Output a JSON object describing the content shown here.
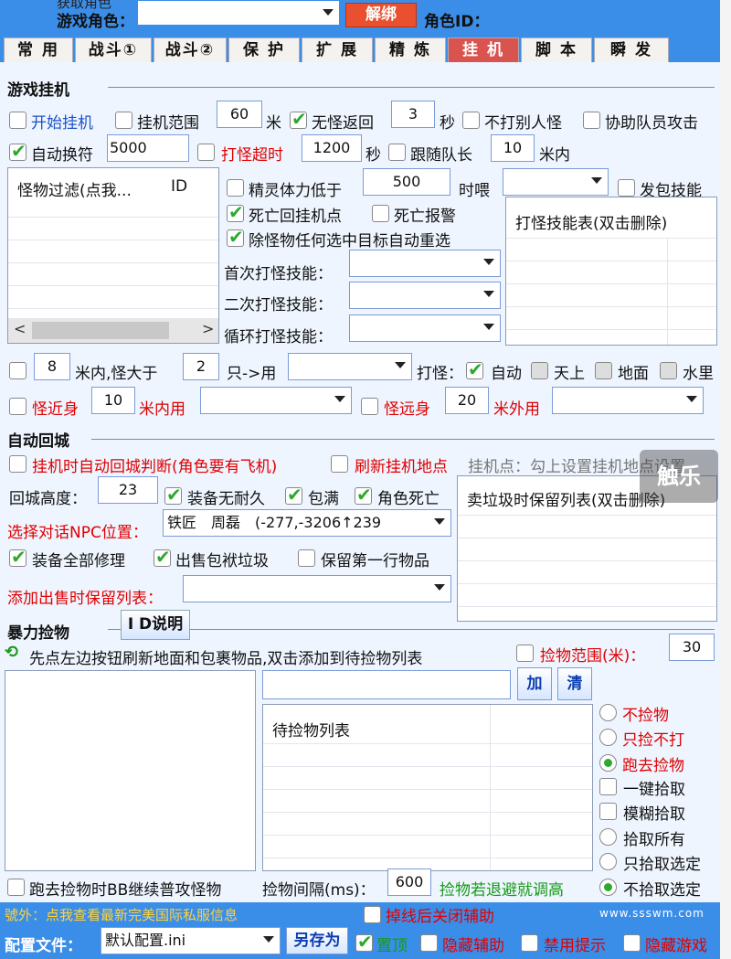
{
  "header": {
    "partial_label": "获取角色",
    "role_label": "游戏角色：",
    "unbind_button": "解绑",
    "role_id_label": "角色ID："
  },
  "tabs": [
    "常 用",
    "战斗①",
    "战斗②",
    "保 护",
    "扩 展",
    "精 炼",
    "挂 机",
    "脚 本",
    "瞬 发"
  ],
  "active_tab": "挂 机",
  "hang": {
    "title": "游戏挂机",
    "start_hang": "开始挂机",
    "hang_range": "挂机范围",
    "hang_range_value": "60",
    "meter": "米",
    "no_monster_return": "无怪返回",
    "no_monster_seconds": "3",
    "seconds": "秒",
    "no_attack_others": "不打别人怪",
    "assist_team": "协助队员攻击",
    "auto_talisman": "自动换符",
    "auto_talisman_value": "5000",
    "attack_timeout": "打怪超时",
    "attack_timeout_value": "1200",
    "seconds2": "秒",
    "follow_leader": "跟随队长",
    "follow_leader_value": "10",
    "within_meters": "米内",
    "filter_col1": "怪物过滤(点我...",
    "filter_col2": "ID",
    "spirit_low": "精灵体力低于",
    "spirit_value": "500",
    "feed_label": "时喂",
    "packet_skill": "发包技能",
    "death_return": "死亡回挂机点",
    "death_alarm": "死亡报警",
    "auto_reselect": "除怪物任何选中目标自动重选",
    "first_skill": "首次打怪技能：",
    "second_skill": "二次打怪技能：",
    "loop_skill": "循环打怪技能：",
    "skill_table": "打怪技能表(双击删除)",
    "range_value": "8",
    "range_text": "米内,怪大于",
    "count_value": "2",
    "use_text": "只->用",
    "attack_label": "打怪：",
    "auto": "自动",
    "sky": "天上",
    "ground": "地面",
    "water": "水里",
    "near_label": "怪近身",
    "near_value": "10",
    "near_use": "米内用",
    "far_label": "怪远身",
    "far_value": "20",
    "far_use": "米外用"
  },
  "town": {
    "title": "自动回城",
    "auto_return_check": "挂机时自动回城判断(角色要有飞机)",
    "refresh_point": "刷新挂机地点",
    "hang_point_hint": "挂机点：勾上设置挂机地点设置",
    "height_label": "回城高度：",
    "height_value": "23",
    "no_durability": "装备无耐久",
    "bag_full": "包满",
    "char_dead": "角色死亡",
    "npc_label": "选择对话NPC位置：",
    "npc_value": "铁匠　周磊　(-277,-3206↑239",
    "keep_list": "卖垃圾时保留列表(双击删除)",
    "repair_all": "装备全部修理",
    "sell_junk": "出售包袱垃圾",
    "keep_first_row": "保留第一行物品",
    "add_keep_label": "添加出售时保留列表："
  },
  "pickup": {
    "title": "暴力捡物",
    "id_help": "I D说明",
    "hint": "先点左边按钮刷新地面和包裹物品,双击添加到待捡物列表",
    "range_label": "捡物范围(米)：",
    "range_value": "30",
    "add_btn": "加",
    "clear_btn": "清",
    "pending_list": "待捡物列表",
    "options": [
      "不捡物",
      "只捡不打",
      "跑去捡物"
    ],
    "one_click": "一键拾取",
    "fuzzy": "模糊拾取",
    "pick_modes": [
      "拾取所有",
      "只拾取选定",
      "不拾取选定"
    ],
    "bb_attack": "跑去捡物时BB继续普攻怪物",
    "interval_label": "捡物间隔(ms)：",
    "interval_value": "600",
    "dodge_hint": "捡物若退避就调高"
  },
  "footer": {
    "news": "號外：点我查看最新完美国际私服信息",
    "close_on_disconnect": "掉线后关闭辅助",
    "website": "www.ssswm.com",
    "config_label": "配置文件：",
    "config_value": "默认配置.ini",
    "save_as": "另存为",
    "topmost": "置顶",
    "hide_helper": "隐藏辅助",
    "disable_tips": "禁用提示",
    "hide_game": "隐藏游戏"
  },
  "watermark": "触乐"
}
